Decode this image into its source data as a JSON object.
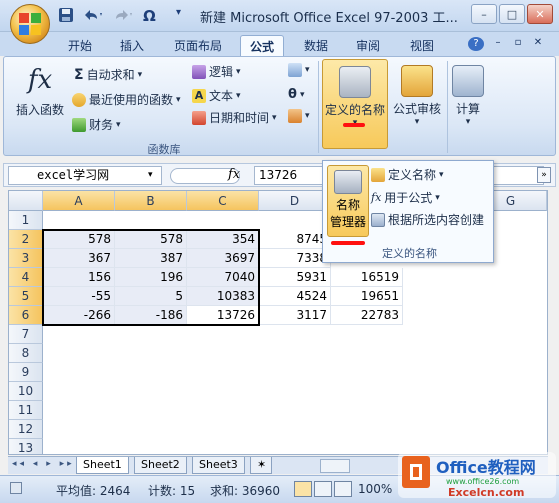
{
  "titlebar": {
    "title": "新建 Microsoft Office Excel 97-2003 工...",
    "qa_icons": [
      "save-icon",
      "undo-icon",
      "redo-icon",
      "omega-icon"
    ],
    "window_buttons": {
      "minimize": "–",
      "maximize": "□",
      "close": "✕"
    }
  },
  "tabs": [
    {
      "label": "开始"
    },
    {
      "label": "插入"
    },
    {
      "label": "页面布局"
    },
    {
      "label": "公式"
    },
    {
      "label": "数据"
    },
    {
      "label": "审阅"
    },
    {
      "label": "视图"
    }
  ],
  "ribbon": {
    "insert_function": "插入函数",
    "autosum": "自动求和",
    "recent": "最近使用的函数",
    "finance": "财务",
    "logic": "逻辑",
    "text": "文本",
    "datetime": "日期和时间",
    "group_library": "函数库",
    "define_names": "定义的名称",
    "formula_audit": "公式审核",
    "calculate": "计算"
  },
  "formula_bar": {
    "namebox": "excel学习网",
    "fx": "fx",
    "value": "13726"
  },
  "columns": [
    "A",
    "B",
    "C",
    "D",
    "E",
    "F",
    "G"
  ],
  "rows": [
    "1",
    "2",
    "3",
    "4",
    "5",
    "6",
    "7",
    "8",
    "9",
    "10",
    "11",
    "12",
    "13"
  ],
  "cells": {
    "A": [
      "",
      "578",
      "367",
      "156",
      "-55",
      "-266"
    ],
    "B": [
      "",
      "578",
      "387",
      "196",
      "5",
      "-186"
    ],
    "C": [
      "",
      "354",
      "3697",
      "7040",
      "10383",
      "13726"
    ],
    "D": [
      "",
      "8745",
      "7338",
      "5931",
      "4524",
      "3117"
    ],
    "E": [
      "",
      "",
      "",
      "16519",
      "19651",
      "22783"
    ]
  },
  "dropdown": {
    "name_manager": "名称",
    "name_manager2": "管理器",
    "define_name": "定义名称",
    "use_in_formula": "用于公式",
    "create_from_selection": "根据所选内容创建",
    "group_label": "定义的名称"
  },
  "sheets": [
    "Sheet1",
    "Sheet2",
    "Sheet3"
  ],
  "status": {
    "average": "平均值: 2464",
    "count": "计数: 15",
    "sum": "求和: 36960",
    "zoom": "100%"
  },
  "watermark": {
    "line1": "Office教程网",
    "line2": "www.office26.com",
    "line3": "Excelcn.com"
  }
}
